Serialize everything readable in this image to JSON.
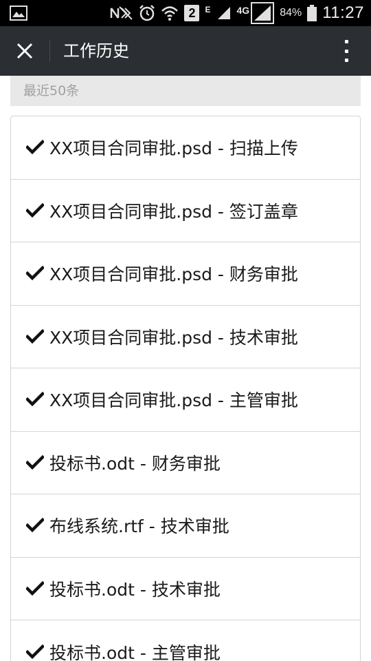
{
  "status_bar": {
    "network_type": "4G",
    "edge_label": "E",
    "sim_badge": "2",
    "battery_percent": "84%",
    "time": "11:27"
  },
  "app_bar": {
    "title": "工作历史",
    "close_icon": "close-icon",
    "more_icon": "more-vertical-icon"
  },
  "section": {
    "header": "最近50条"
  },
  "history": {
    "items": [
      {
        "label": "XX项目合同审批.psd - 扫描上传"
      },
      {
        "label": "XX项目合同审批.psd - 签订盖章"
      },
      {
        "label": "XX项目合同审批.psd - 财务审批"
      },
      {
        "label": "XX项目合同审批.psd - 技术审批"
      },
      {
        "label": "XX项目合同审批.psd - 主管审批"
      },
      {
        "label": "投标书.odt - 财务审批"
      },
      {
        "label": "布线系统.rtf - 技术审批"
      },
      {
        "label": "投标书.odt - 技术审批"
      },
      {
        "label": "投标书.odt - 主管审批"
      }
    ]
  },
  "colors": {
    "app_bar_bg": "#2b2e32",
    "status_bar_bg": "#000000",
    "section_header_bg": "#e8e8e8",
    "section_header_text": "#a0a0a0",
    "list_border": "#d4d4d4",
    "item_text": "#1a1a1a"
  }
}
